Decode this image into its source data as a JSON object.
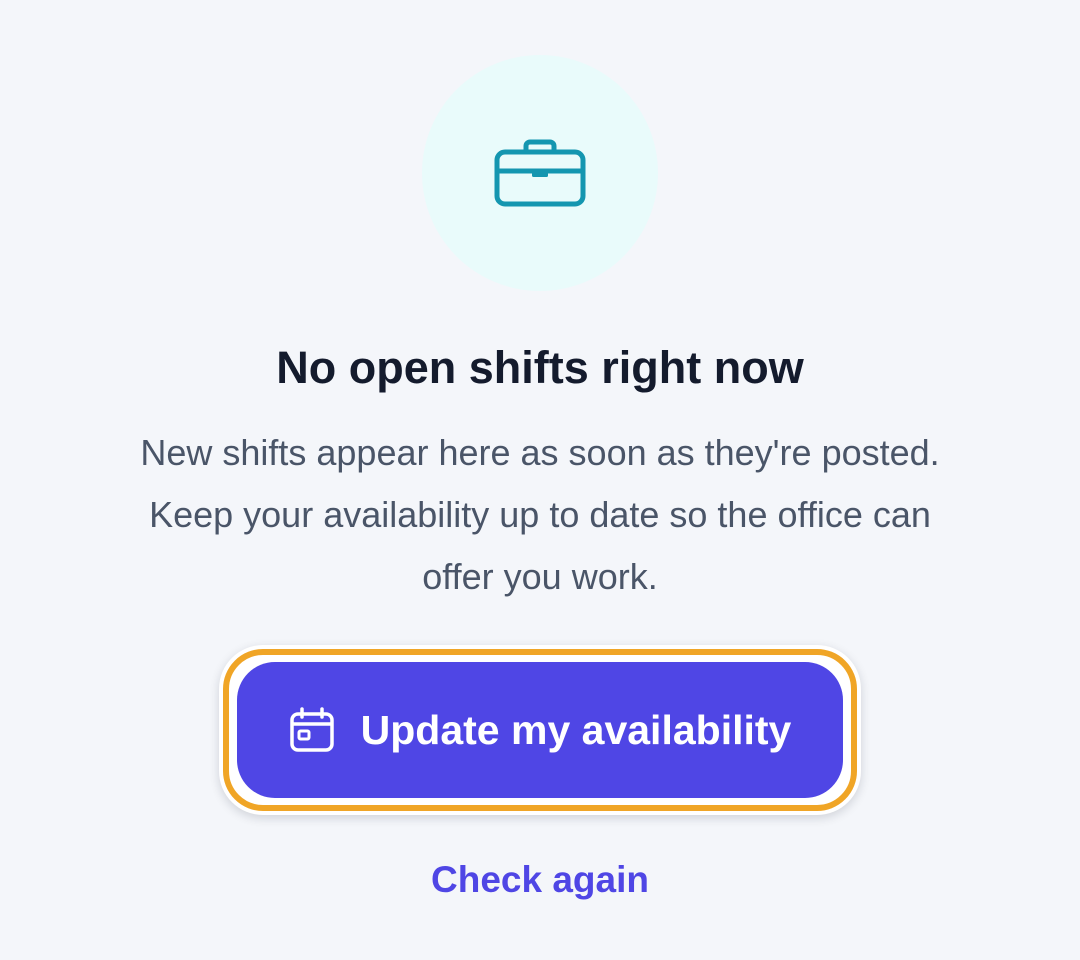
{
  "empty_state": {
    "icon": "briefcase-icon",
    "title": "No open shifts right now",
    "description": "New shifts appear here as soon as they're posted. Keep your availability up to date so the office can offer you work.",
    "primary_action": {
      "label": "Update my availability",
      "icon": "calendar-icon",
      "focused": true
    },
    "secondary_action": {
      "label": "Check again"
    }
  },
  "colors": {
    "background": "#f4f6fa",
    "icon_circle": "#e9fbfb",
    "icon_stroke": "#1496b0",
    "title": "#141b2d",
    "body_text": "#4a5568",
    "accent": "#4f46e5",
    "focus_ring": "#f0a526"
  }
}
